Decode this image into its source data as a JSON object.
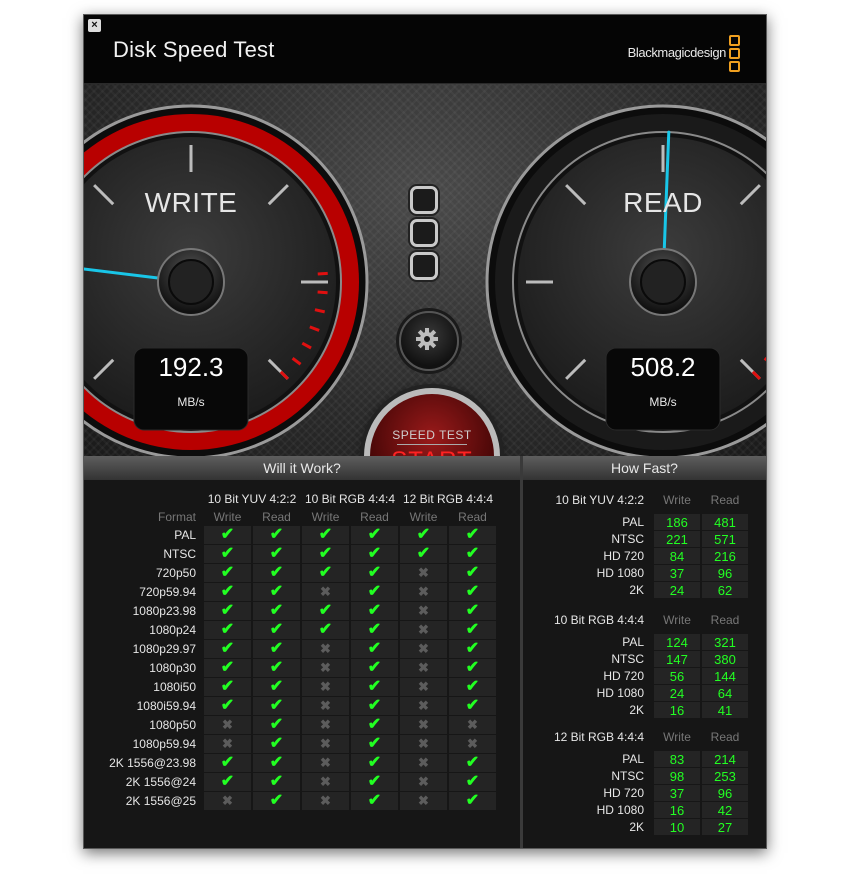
{
  "window": {
    "title": "Disk Speed Test",
    "close_label": "×",
    "brand": "Blackmagicdesign"
  },
  "colors": {
    "accent_red": "#cc0000",
    "needle": "#19c6e8",
    "ok": "#22ff22",
    "bg": "#121212"
  },
  "gauges": {
    "write": {
      "label": "WRITE",
      "value": "192.3",
      "unit": "MB/s",
      "needle_value": 192.3
    },
    "read": {
      "label": "READ",
      "value": "508.2",
      "unit": "MB/s",
      "needle_value": 508.2
    }
  },
  "controls": {
    "start_small": "SPEED TEST",
    "start_big": "START",
    "settings_icon": "gear-icon"
  },
  "will_it_work": {
    "title": "Will it Work?",
    "format_header": "Format",
    "groups": [
      "10 Bit YUV 4:2:2",
      "10 Bit RGB 4:4:4",
      "12 Bit RGB 4:4:4"
    ],
    "sub_headers": [
      "Write",
      "Read"
    ],
    "rows": [
      {
        "format": "PAL",
        "cells": [
          true,
          true,
          true,
          true,
          true,
          true
        ]
      },
      {
        "format": "NTSC",
        "cells": [
          true,
          true,
          true,
          true,
          true,
          true
        ]
      },
      {
        "format": "720p50",
        "cells": [
          true,
          true,
          true,
          true,
          false,
          true
        ]
      },
      {
        "format": "720p59.94",
        "cells": [
          true,
          true,
          false,
          true,
          false,
          true
        ]
      },
      {
        "format": "1080p23.98",
        "cells": [
          true,
          true,
          true,
          true,
          false,
          true
        ]
      },
      {
        "format": "1080p24",
        "cells": [
          true,
          true,
          true,
          true,
          false,
          true
        ]
      },
      {
        "format": "1080p29.97",
        "cells": [
          true,
          true,
          false,
          true,
          false,
          true
        ]
      },
      {
        "format": "1080p30",
        "cells": [
          true,
          true,
          false,
          true,
          false,
          true
        ]
      },
      {
        "format": "1080i50",
        "cells": [
          true,
          true,
          false,
          true,
          false,
          true
        ]
      },
      {
        "format": "1080i59.94",
        "cells": [
          true,
          true,
          false,
          true,
          false,
          true
        ]
      },
      {
        "format": "1080p50",
        "cells": [
          false,
          true,
          false,
          true,
          false,
          false
        ]
      },
      {
        "format": "1080p59.94",
        "cells": [
          false,
          true,
          false,
          true,
          false,
          false
        ]
      },
      {
        "format": "2K 1556@23.98",
        "cells": [
          true,
          true,
          false,
          true,
          false,
          true
        ]
      },
      {
        "format": "2K 1556@24",
        "cells": [
          true,
          true,
          false,
          true,
          false,
          true
        ]
      },
      {
        "format": "2K 1556@25",
        "cells": [
          false,
          true,
          false,
          true,
          false,
          true
        ]
      }
    ]
  },
  "how_fast": {
    "title": "How Fast?",
    "groups": [
      {
        "name": "10 Bit YUV 4:2:2",
        "write_label": "Write",
        "read_label": "Read",
        "rows": [
          [
            "PAL",
            "186",
            "481"
          ],
          [
            "NTSC",
            "221",
            "571"
          ],
          [
            "HD 720",
            "84",
            "216"
          ],
          [
            "HD 1080",
            "37",
            "96"
          ],
          [
            "2K",
            "24",
            "62"
          ]
        ]
      },
      {
        "name": "10 Bit RGB 4:4:4",
        "write_label": "Write",
        "read_label": "Read",
        "rows": [
          [
            "PAL",
            "124",
            "321"
          ],
          [
            "NTSC",
            "147",
            "380"
          ],
          [
            "HD 720",
            "56",
            "144"
          ],
          [
            "HD 1080",
            "24",
            "64"
          ],
          [
            "2K",
            "16",
            "41"
          ]
        ]
      },
      {
        "name": "12 Bit RGB 4:4:4",
        "write_label": "Write",
        "read_label": "Read",
        "rows": [
          [
            "PAL",
            "83",
            "214"
          ],
          [
            "NTSC",
            "98",
            "253"
          ],
          [
            "HD 720",
            "37",
            "96"
          ],
          [
            "HD 1080",
            "16",
            "42"
          ],
          [
            "2K",
            "10",
            "27"
          ]
        ]
      }
    ]
  }
}
